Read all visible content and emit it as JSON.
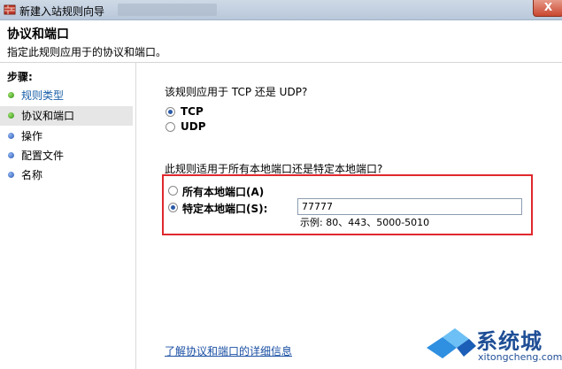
{
  "window": {
    "title": "新建入站规则向导",
    "close_label": "X"
  },
  "header": {
    "title": "协议和端口",
    "subtitle": "指定此规则应用于的协议和端口。"
  },
  "steps": {
    "heading": "步骤:",
    "items": [
      {
        "label": "规则类型",
        "state": "done",
        "dot_color": "#2e8f16"
      },
      {
        "label": "协议和端口",
        "state": "current",
        "dot_color": "#2e8f16"
      },
      {
        "label": "操作",
        "state": "pending",
        "dot_color": "#2b58b5"
      },
      {
        "label": "配置文件",
        "state": "pending",
        "dot_color": "#2b58b5"
      },
      {
        "label": "名称",
        "state": "pending",
        "dot_color": "#2b58b5"
      }
    ]
  },
  "protocol": {
    "question": "该规则应用于 TCP 还是 UDP?",
    "options": [
      {
        "label": "TCP",
        "selected": true
      },
      {
        "label": "UDP",
        "selected": false
      }
    ]
  },
  "ports": {
    "question": "此规则适用于所有本地端口还是特定本地端口?",
    "options": [
      {
        "label": "所有本地端口(A)",
        "selected": false
      },
      {
        "label": "特定本地端口(S):",
        "selected": true
      }
    ],
    "value": "77777",
    "example": "示例: 80、443、5000-5010"
  },
  "link_text": "了解协议和端口的详细信息",
  "watermark": {
    "brand": "系统城",
    "domain": "xitongcheng.com"
  },
  "colors": {
    "highlight": "#e0282e",
    "link": "#1a4fa3",
    "accent": "#2b5aa8"
  }
}
